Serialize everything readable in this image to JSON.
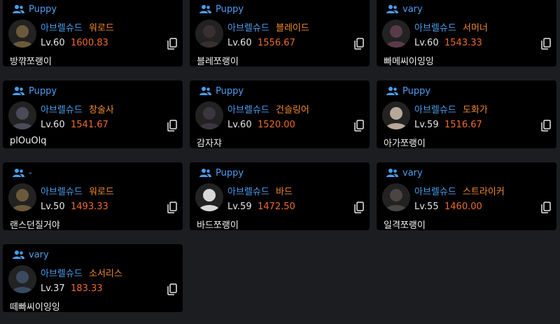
{
  "cards": [
    {
      "party": "Puppy",
      "server": "아브렐슈드",
      "class": "워로드",
      "level": "Lv.60",
      "score": "1600.83",
      "name": "방꺆쪼랭이",
      "avatar_tone": "#6b5a3a"
    },
    {
      "party": "Puppy",
      "server": "아브렐슈드",
      "class": "블레이드",
      "level": "Lv.60",
      "score": "1556.67",
      "name": "블레쪼랭이",
      "avatar_tone": "#3a2f30"
    },
    {
      "party": "vary",
      "server": "아브렐슈드",
      "class": "서머너",
      "level": "Lv.60",
      "score": "1543.33",
      "name": "빠메씨이잉잉",
      "avatar_tone": "#5a3a48"
    },
    {
      "party": "Puppy",
      "server": "아브렐슈드",
      "class": "창술사",
      "level": "Lv.60",
      "score": "1541.67",
      "name": "plOuOlq",
      "avatar_tone": "#4a4a58"
    },
    {
      "party": "Puppy",
      "server": "아브렐슈드",
      "class": "건슬링어",
      "level": "Lv.60",
      "score": "1520.00",
      "name": "감자쟈",
      "avatar_tone": "#3a3540"
    },
    {
      "party": "Puppy",
      "server": "아브렐슈드",
      "class": "도화가",
      "level": "Lv.59",
      "score": "1516.67",
      "name": "아가쪼랭이",
      "avatar_tone": "#b8a898"
    },
    {
      "party": "-",
      "server": "아브렐슈드",
      "class": "워로드",
      "level": "Lv.50",
      "score": "1493.33",
      "name": "랜스던질거야",
      "avatar_tone": "#6b5a3a"
    },
    {
      "party": "Puppy",
      "server": "아브렐슈드",
      "class": "바드",
      "level": "Lv.59",
      "score": "1472.50",
      "name": "바드쪼랭이",
      "avatar_tone": "#d8d8d8"
    },
    {
      "party": "vary",
      "server": "아브렐슈드",
      "class": "스트라이커",
      "level": "Lv.55",
      "score": "1460.00",
      "name": "일격쪼랭이",
      "avatar_tone": "#4a4540"
    },
    {
      "party": "vary",
      "server": "아브렐슈드",
      "class": "소서리스",
      "level": "Lv.37",
      "score": "183.33",
      "name": "떼빠씨이잉잉",
      "avatar_tone": "#3a4a60"
    }
  ],
  "colors": {
    "party": "#4a9ff0",
    "server": "#4a9ff0",
    "class": "#f08a2a",
    "score": "#f06a2a",
    "card_bg": "#000000",
    "page_bg": "#1c1d21"
  },
  "icons": {
    "party": "users-icon",
    "copy": "copy-icon"
  }
}
